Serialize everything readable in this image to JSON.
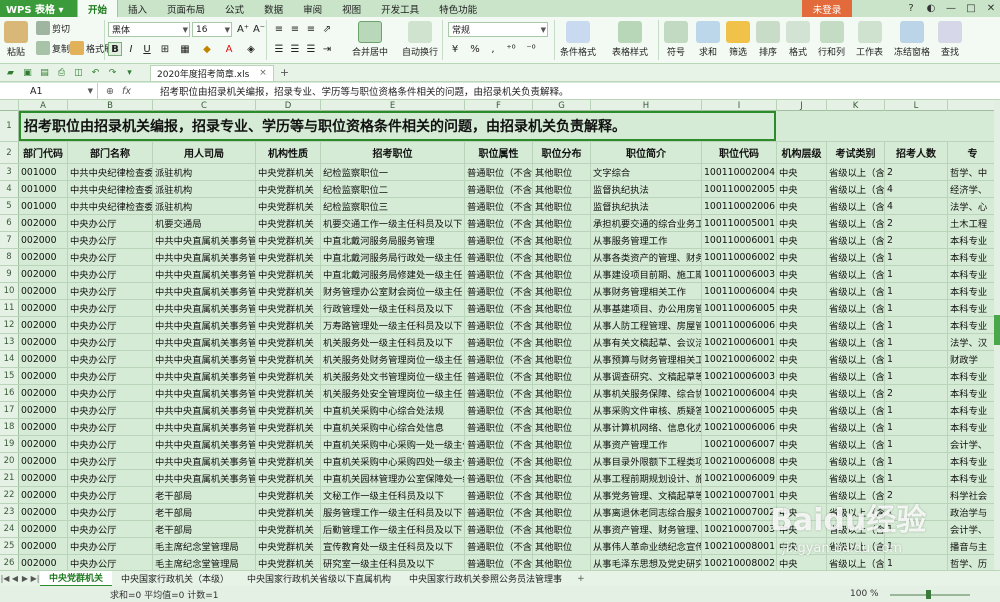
{
  "app": {
    "logo": "WPS 表格 ▾",
    "login": "未登录"
  },
  "menu_tabs": [
    "开始",
    "插入",
    "页面布局",
    "公式",
    "数据",
    "审阅",
    "视图",
    "开发工具",
    "特色功能"
  ],
  "ribbon": {
    "paste": "粘贴",
    "cut": "剪切",
    "copy": "复制",
    "format_painter": "格式刷",
    "font": "黑体",
    "size": "16",
    "merge": "合并居中",
    "wrap": "自动换行",
    "number_format": "常规",
    "cond_format": "条件格式",
    "table_style": "表格样式",
    "symbol": "符号",
    "sum": "求和",
    "filter": "筛选",
    "sort": "排序",
    "format": "格式",
    "row_col": "行和列",
    "sheet": "工作表",
    "freeze": "冻结窗格",
    "find": "查找"
  },
  "doc": {
    "name": "2020年度招考简章.xls"
  },
  "formula": {
    "cell": "A1",
    "fx": "fx",
    "value": "招考职位由招录机关编报，招录专业、学历等与职位资格条件相关的问题，由招录机关负责解释。"
  },
  "columns": [
    "A",
    "B",
    "C",
    "D",
    "E",
    "F",
    "G",
    "H",
    "I",
    "J",
    "K",
    "L"
  ],
  "title_row": "招考职位由招录机关编报，招录专业、学历等与职位资格条件相关的问题，由招录机关负责解释。",
  "headers": [
    "部门代码",
    "部门名称",
    "用人司局",
    "机构性质",
    "招考职位",
    "职位属性",
    "职位分布",
    "职位简介",
    "职位代码",
    "机构层级",
    "考试类别",
    "招考人数",
    "专"
  ],
  "rows": [
    [
      "001000",
      "中共中央纪律检查委员会",
      "派驻机构",
      "中央党群机关",
      "纪检监察职位一",
      "普通职位（不含",
      "其他职位",
      "文字综合",
      "100110002004",
      "中央",
      "省级以上（含",
      "2",
      "哲学、中"
    ],
    [
      "001000",
      "中共中央纪律检查委员会",
      "派驻机构",
      "中央党群机关",
      "纪检监察职位二",
      "普通职位（不含",
      "其他职位",
      "监督执纪执法",
      "100110002005",
      "中央",
      "省级以上（含",
      "4",
      "经济学、"
    ],
    [
      "001000",
      "中共中央纪律检查委员会",
      "派驻机构",
      "中央党群机关",
      "纪检监察职位三",
      "普通职位（不含",
      "其他职位",
      "监督执纪执法",
      "100110002006",
      "中央",
      "省级以上（含",
      "4",
      "法学、心"
    ],
    [
      "002000",
      "中央办公厅",
      "机要交通局",
      "中央党群机关",
      "机要交通工作一级主任科员及以下",
      "普通职位（不含",
      "其他职位",
      "承担机要交通的综合业务工",
      "100110005001",
      "中央",
      "省级以上（含",
      "2",
      "土木工程"
    ],
    [
      "002000",
      "中央办公厅",
      "中共中央直属机关事务管理局",
      "中央党群机关",
      "中直北戴河服务局服务管理",
      "普通职位（不含",
      "其他职位",
      "从事服务管理工作",
      "100110006001",
      "中央",
      "省级以上（含",
      "2",
      "本科专业"
    ],
    [
      "002000",
      "中央办公厅",
      "中共中央直属机关事务管理局",
      "中央党群机关",
      "中直北戴河服务局行政处一级主任",
      "普通职位（不含",
      "其他职位",
      "从事各类资产的管理、财务",
      "100110006002",
      "中央",
      "省级以上（含",
      "1",
      "本科专业"
    ],
    [
      "002000",
      "中央办公厅",
      "中共中央直属机关事务管理局",
      "中央党群机关",
      "中直北戴河服务局修建处一级主任",
      "普通职位（不含",
      "其他职位",
      "从事建设项目前期、施工期",
      "100110006003",
      "中央",
      "省级以上（含",
      "1",
      "本科专业"
    ],
    [
      "002000",
      "中央办公厅",
      "中共中央直属机关事务管理局",
      "中央党群机关",
      "财务管理办公室财会岗位一级主任",
      "普通职位（不含",
      "其他职位",
      "从事财务管理相关工作",
      "100110006004",
      "中央",
      "省级以上（含",
      "1",
      "本科专业"
    ],
    [
      "002000",
      "中央办公厅",
      "中共中央直属机关事务管理局",
      "中央党群机关",
      "行政管理处一级主任科员及以下",
      "普通职位（不含",
      "其他职位",
      "从事基建项目、办公用房管",
      "100110006005",
      "中央",
      "省级以上（含",
      "1",
      "本科专业"
    ],
    [
      "002000",
      "中央办公厅",
      "中共中央直属机关事务管理局",
      "中央党群机关",
      "万寿路管理处一级主任科员及以下",
      "普通职位（不含",
      "其他职位",
      "从事人防工程管理、房屋管",
      "100110006006",
      "中央",
      "省级以上（含",
      "1",
      "本科专业"
    ],
    [
      "002000",
      "中央办公厅",
      "中共中央直属机关事务管理局",
      "中央党群机关",
      "机关服务处一级主任科员及以下",
      "普通职位（不含",
      "其他职位",
      "从事有关文稿起草、会议活",
      "100210006001",
      "中央",
      "省级以上（含",
      "1",
      "法学、汉"
    ],
    [
      "002000",
      "中央办公厅",
      "中共中央直属机关事务管理局",
      "中央党群机关",
      "机关服务处财务管理岗位一级主任",
      "普通职位（不含",
      "其他职位",
      "从事预算与财务管理相关工",
      "100210006002",
      "中央",
      "省级以上（含",
      "1",
      "财政学"
    ],
    [
      "002000",
      "中央办公厅",
      "中共中央直属机关事务管理局",
      "中央党群机关",
      "机关服务处文书管理岗位一级主任",
      "普通职位（不含",
      "其他职位",
      "从事调查研究、文稿起草等",
      "100210006003",
      "中央",
      "省级以上（含",
      "1",
      "本科专业"
    ],
    [
      "002000",
      "中央办公厅",
      "中共中央直属机关事务管理局",
      "中央党群机关",
      "机关服务处安全管理岗位一级主任",
      "普通职位（不含",
      "其他职位",
      "从事机关服务保障、综合协",
      "100210006004",
      "中央",
      "省级以上（含",
      "2",
      "本科专业"
    ],
    [
      "002000",
      "中央办公厅",
      "中共中央直属机关事务管理局",
      "中央党群机关",
      "中直机关采购中心综合处法规",
      "普通职位（不含",
      "其他职位",
      "从事采购文件审核、质疑答",
      "100210006005",
      "中央",
      "省级以上（含",
      "1",
      "本科专业"
    ],
    [
      "002000",
      "中央办公厅",
      "中共中央直属机关事务管理局",
      "中央党群机关",
      "中直机关采购中心综合处信息",
      "普通职位（不含",
      "其他职位",
      "从事计算机网络、信息化办",
      "100210006006",
      "中央",
      "省级以上（含",
      "1",
      "本科专业"
    ],
    [
      "002000",
      "中央办公厅",
      "中共中央直属机关事务管理局",
      "中央党群机关",
      "中直机关采购中心采购一处一级主任",
      "普通职位（不含",
      "其他职位",
      "从事资产管理工作",
      "100210006007",
      "中央",
      "省级以上（含",
      "1",
      "会计学、"
    ],
    [
      "002000",
      "中央办公厅",
      "中共中央直属机关事务管理局",
      "中央党群机关",
      "中直机关采购中心采购四处一级主任",
      "普通职位（不含",
      "其他职位",
      "从事目录外限额下工程类项",
      "100210006008",
      "中央",
      "省级以上（含",
      "1",
      "本科专业"
    ],
    [
      "002000",
      "中央办公厅",
      "中共中央直属机关事务管理局",
      "中央党群机关",
      "中直机关园林管理办公室保障处一级",
      "普通职位（不含",
      "其他职位",
      "从事工程前期规划设计、施",
      "100210006009",
      "中央",
      "省级以上（含",
      "1",
      "本科专业"
    ],
    [
      "002000",
      "中央办公厅",
      "老干部局",
      "中央党群机关",
      "文秘工作一级主任科员及以下",
      "普通职位（不含",
      "其他职位",
      "从事党务管理、文稿起草等",
      "100210007001",
      "中央",
      "省级以上（含",
      "2",
      "科学社会"
    ],
    [
      "002000",
      "中央办公厅",
      "老干部局",
      "中央党群机关",
      "服务管理工作一级主任科员及以下",
      "普通职位（不含",
      "其他职位",
      "从事离退休老同志综合服务",
      "100210007002",
      "中央",
      "省级以上（含",
      "1",
      "政治学与"
    ],
    [
      "002000",
      "中央办公厅",
      "老干部局",
      "中央党群机关",
      "后勤管理工作一级主任科员及以下",
      "普通职位（不含",
      "其他职位",
      "从事资产管理、财务管理、",
      "100210007003",
      "中央",
      "省级以上（含",
      "1",
      "会计学、"
    ],
    [
      "002000",
      "中央办公厅",
      "毛主席纪念堂管理局",
      "中央党群机关",
      "宣传教育处一级主任科员及以下",
      "普通职位（不含",
      "其他职位",
      "从事伟人革命业绩纪念宣传",
      "100210008001",
      "中央",
      "省级以上（含",
      "1",
      "播音与主"
    ],
    [
      "002000",
      "中央办公厅",
      "毛主席纪念堂管理局",
      "中央党群机关",
      "研究室一级主任科员及以下",
      "普通职位（不含",
      "其他职位",
      "从事毛泽东思想及党史研究",
      "100210008002",
      "中央",
      "省级以上（含",
      "1",
      "哲学、历"
    ]
  ],
  "sheets": [
    "中央党群机关",
    "中央国家行政机关（本级）",
    "中央国家行政机关省级以下直属机构",
    "中央国家行政机关参照公务员法管理事"
  ],
  "status": {
    "text": "求和=0   平均值=0   计数=1",
    "zoom": "100 %"
  },
  "watermark": {
    "main": "Baidu经验",
    "sub": "jingyan.baidu.com"
  }
}
